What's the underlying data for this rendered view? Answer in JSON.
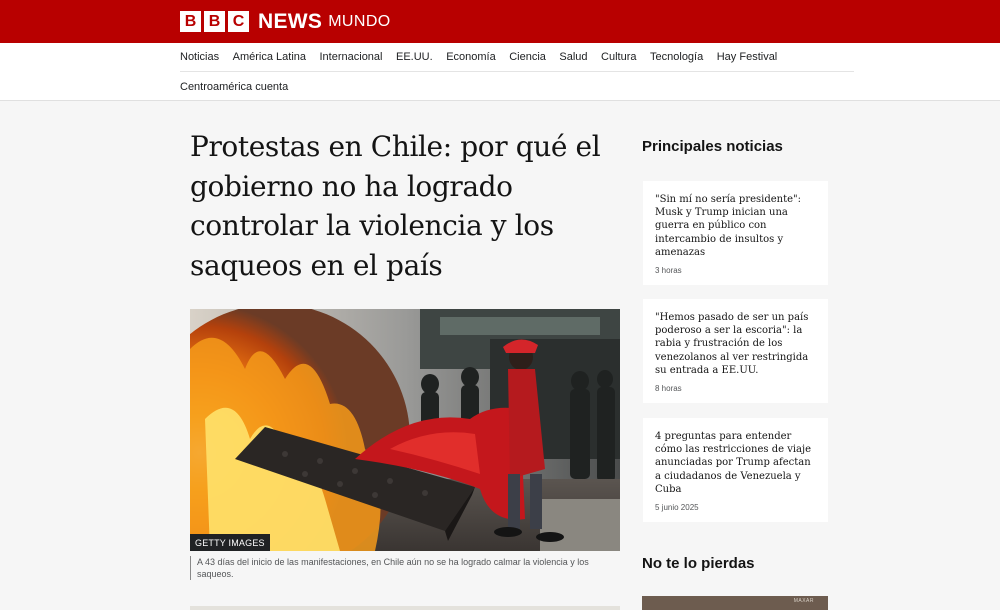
{
  "brand": {
    "letters": [
      "B",
      "B",
      "C"
    ],
    "news": "NEWS",
    "edition": "MUNDO",
    "color": "#b80000"
  },
  "nav": {
    "row1": [
      "Noticias",
      "América Latina",
      "Internacional",
      "EE.UU.",
      "Economía",
      "Ciencia",
      "Salud",
      "Cultura",
      "Tecnología",
      "Hay Festival"
    ],
    "row2": [
      "Centroamérica cuenta"
    ]
  },
  "article": {
    "headline": "Protestas en Chile: por qué el gobierno no ha logrado controlar la violencia y los saqueos en el país",
    "image_credit": "GETTY IMAGES",
    "caption": "A 43 días del inicio de las manifestaciones, en Chile aún no se ha logrado calmar la violencia y los saqueos."
  },
  "sidebar": {
    "top_title": "Principales noticias",
    "stories": [
      {
        "text": "\"Sin mí no sería presidente\": Musk y Trump inician una guerra en público con intercambio de insultos y amenazas",
        "time": "3 horas"
      },
      {
        "text": "\"Hemos pasado de ser un país poderoso a ser la escoria\": la rabia y frustración de los venezolanos al ver restringida su entrada a EE.UU.",
        "time": "8 horas"
      },
      {
        "text": "4 preguntas para entender cómo las restricciones de viaje anunciadas por Trump afectan a ciudadanos de Venezuela y Cuba",
        "time": "5 junio 2025"
      }
    ],
    "more_title": "No te lo pierdas",
    "thumb_label": "MAXAR"
  }
}
